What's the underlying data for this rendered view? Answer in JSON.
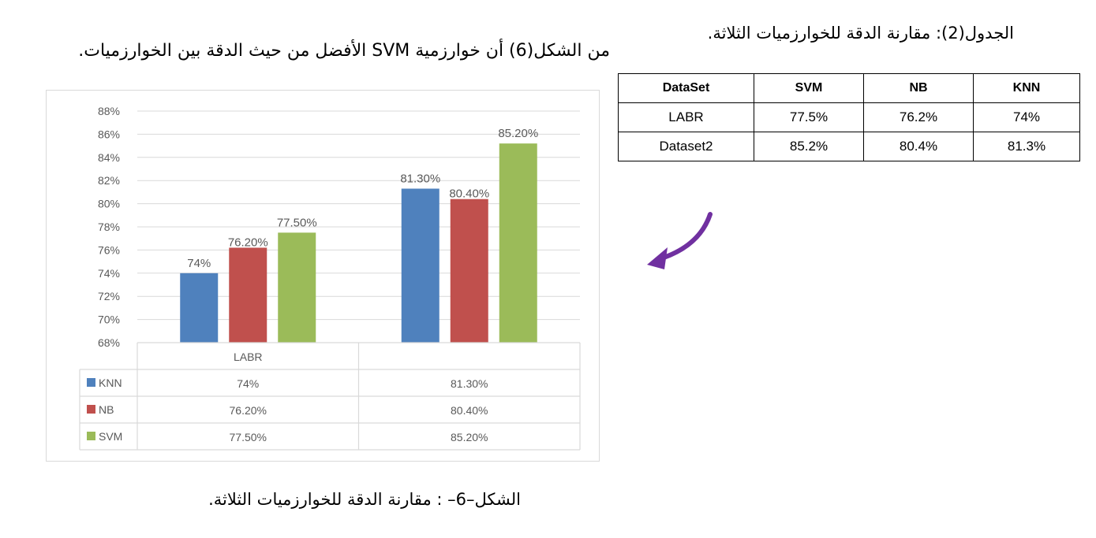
{
  "text": {
    "line_left": "من الشكل(6) أن خوارزمية SVM الأفضل من حيث الدقة بين الخوارزميات.",
    "line_right": "الجدول(2): مقارنة الدقة للخوارزميات الثلاثة.",
    "caption": "الشكل–6– : مقارنة الدقة للخوارزميات الثلاثة."
  },
  "table": {
    "headers": [
      "DataSet",
      "SVM",
      "NB",
      "KNN"
    ],
    "rows": [
      [
        "LABR",
        "77.5%",
        "76.2%",
        "74%"
      ],
      [
        "Dataset2",
        "85.2%",
        "80.4%",
        "81.3%"
      ]
    ]
  },
  "chart_data": {
    "type": "bar",
    "categories": [
      "LABR",
      ""
    ],
    "series": [
      {
        "name": "KNN",
        "values": [
          74,
          81.3
        ],
        "labels": [
          "74%",
          "81.30%"
        ],
        "color": "#4f81bd"
      },
      {
        "name": "NB",
        "values": [
          76.2,
          80.4
        ],
        "labels": [
          "76.20%",
          "80.40%"
        ],
        "color": "#c0504d"
      },
      {
        "name": "SVM",
        "values": [
          77.5,
          85.2
        ],
        "labels": [
          "77.50%",
          "85.20%"
        ],
        "color": "#9bbb59"
      }
    ],
    "ylim": [
      68,
      88
    ],
    "yticks": [
      "68%",
      "70%",
      "72%",
      "74%",
      "76%",
      "78%",
      "80%",
      "82%",
      "84%",
      "86%",
      "88%"
    ],
    "grid": true,
    "legend": "data-table",
    "data_table": true
  },
  "colors": {
    "arrow": "#7030a0",
    "gridline": "#d9d9d9",
    "axis_text": "#595959"
  }
}
